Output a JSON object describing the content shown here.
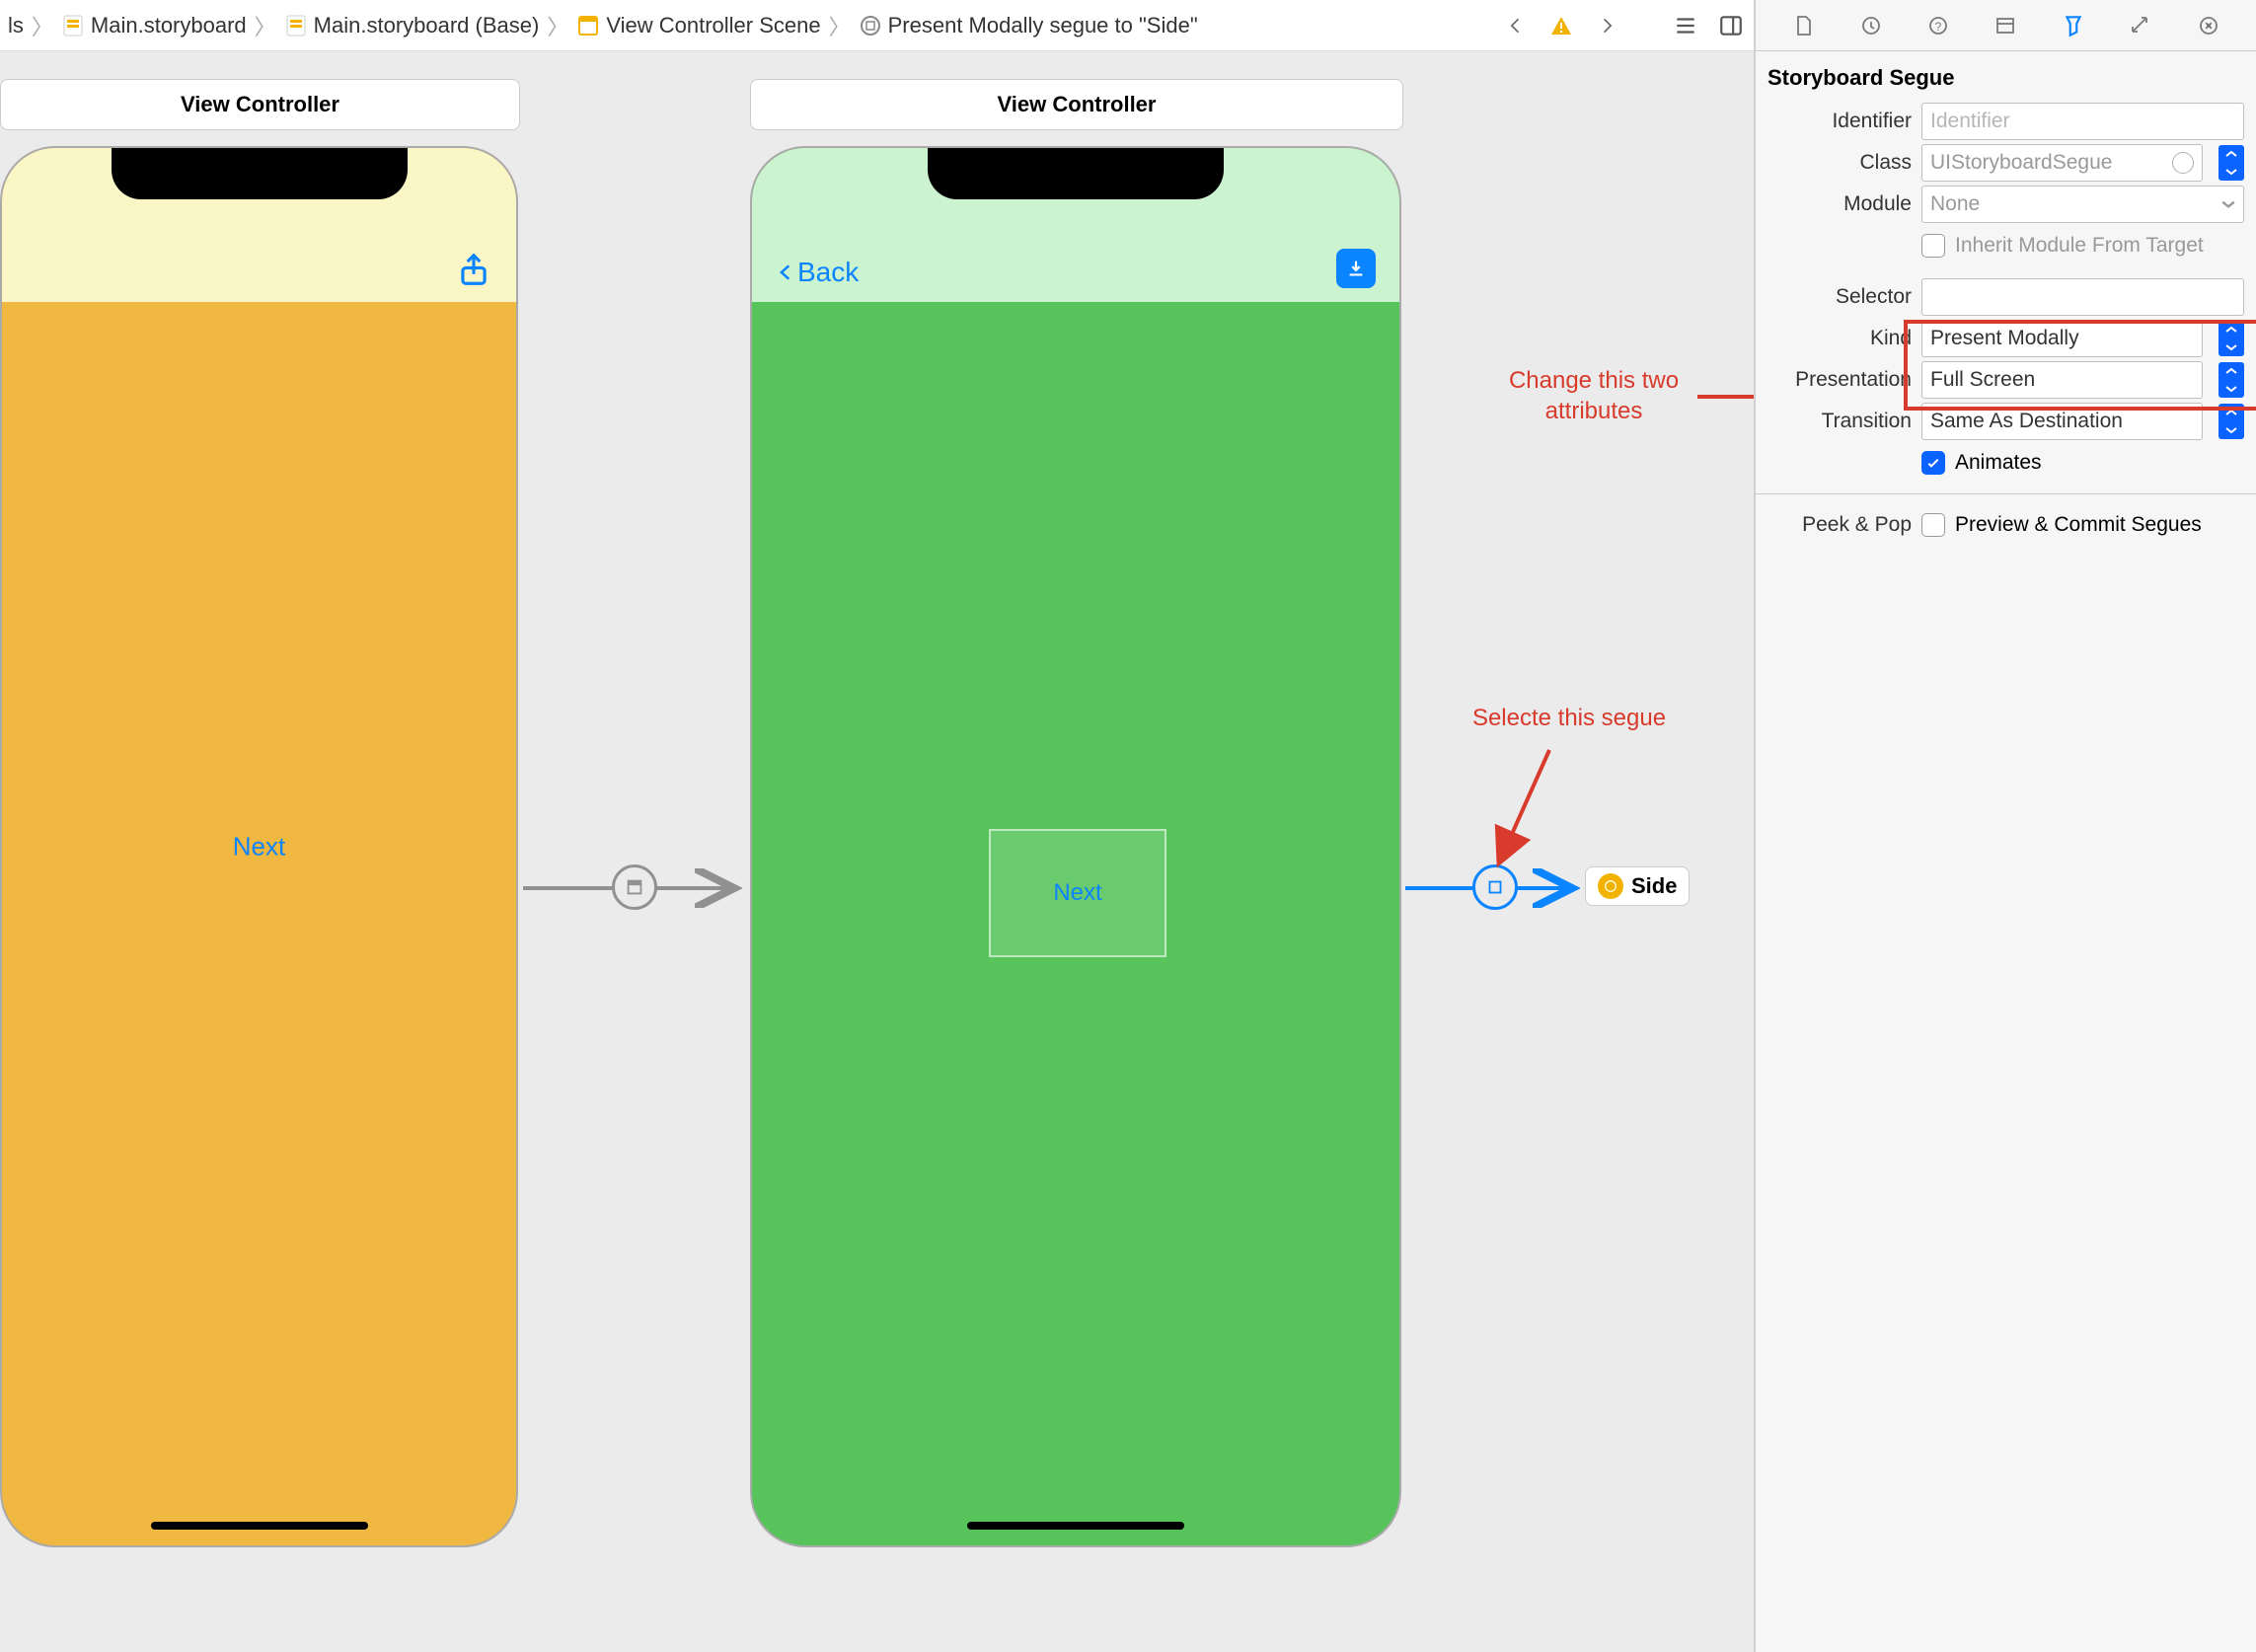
{
  "breadcrumbs": {
    "item0": "ls",
    "item1": "Main.storyboard",
    "item2": "Main.storyboard (Base)",
    "item3": "View Controller Scene",
    "item4": "Present Modally segue to \"Side\""
  },
  "scene1": {
    "title": "View Controller",
    "button": "Next"
  },
  "scene2": {
    "title": "View Controller",
    "back": "Back",
    "container_button": "Next"
  },
  "segue_target_label": "Side",
  "annotations": {
    "change_attrs": "Change this two\nattributes",
    "select_segue": "Selecte this segue"
  },
  "inspector": {
    "section": "Storyboard Segue",
    "identifier_label": "Identifier",
    "identifier_placeholder": "Identifier",
    "class_label": "Class",
    "class_value": "UIStoryboardSegue",
    "module_label": "Module",
    "module_value": "None",
    "inherit_label": "Inherit Module From Target",
    "selector_label": "Selector",
    "kind_label": "Kind",
    "kind_value": "Present Modally",
    "presentation_label": "Presentation",
    "presentation_value": "Full Screen",
    "transition_label": "Transition",
    "transition_value": "Same As Destination",
    "animates_label": "Animates",
    "peekpop_label": "Peek & Pop",
    "peekpop_value": "Preview & Commit Segues"
  }
}
